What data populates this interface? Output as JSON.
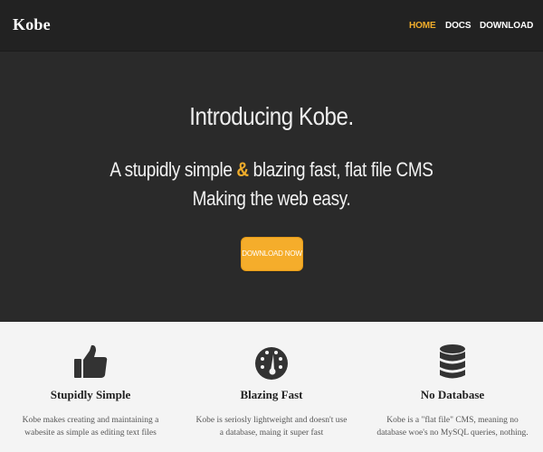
{
  "navbar": {
    "brand": "Kobe",
    "links": [
      {
        "label": "HOME",
        "active": true
      },
      {
        "label": "DOCS",
        "active": false
      },
      {
        "label": "DOWNLOAD",
        "active": false
      }
    ]
  },
  "hero": {
    "title": "Introducing Kobe.",
    "subtitle_before": "A stupidly simple ",
    "subtitle_amp": "&",
    "subtitle_after": " blazing fast, flat file CMS",
    "subtitle_line2": "Making the web easy.",
    "button_label": "DOWNLOAD NOW"
  },
  "features": [
    {
      "icon": "thumbs-up-icon",
      "title": "Stupidly Simple",
      "text": "Kobe makes creating and maintaining a wabesite as simple as editing text files"
    },
    {
      "icon": "dashboard-icon",
      "title": "Blazing Fast",
      "text": "Kobe is seriosly lightweight and doesn't use a database, maing it super fast"
    },
    {
      "icon": "database-icon",
      "title": "No Database",
      "text": "Kobe is a \"flat file\" CMS, meaning no database woe's no MySQL queries, nothing."
    }
  ],
  "colors": {
    "nav_bg": "#222222",
    "hero_bg": "#2a2a2a",
    "accent": "#f0ad2b",
    "feature_bg": "#f4f4f4",
    "icon": "#333333"
  }
}
